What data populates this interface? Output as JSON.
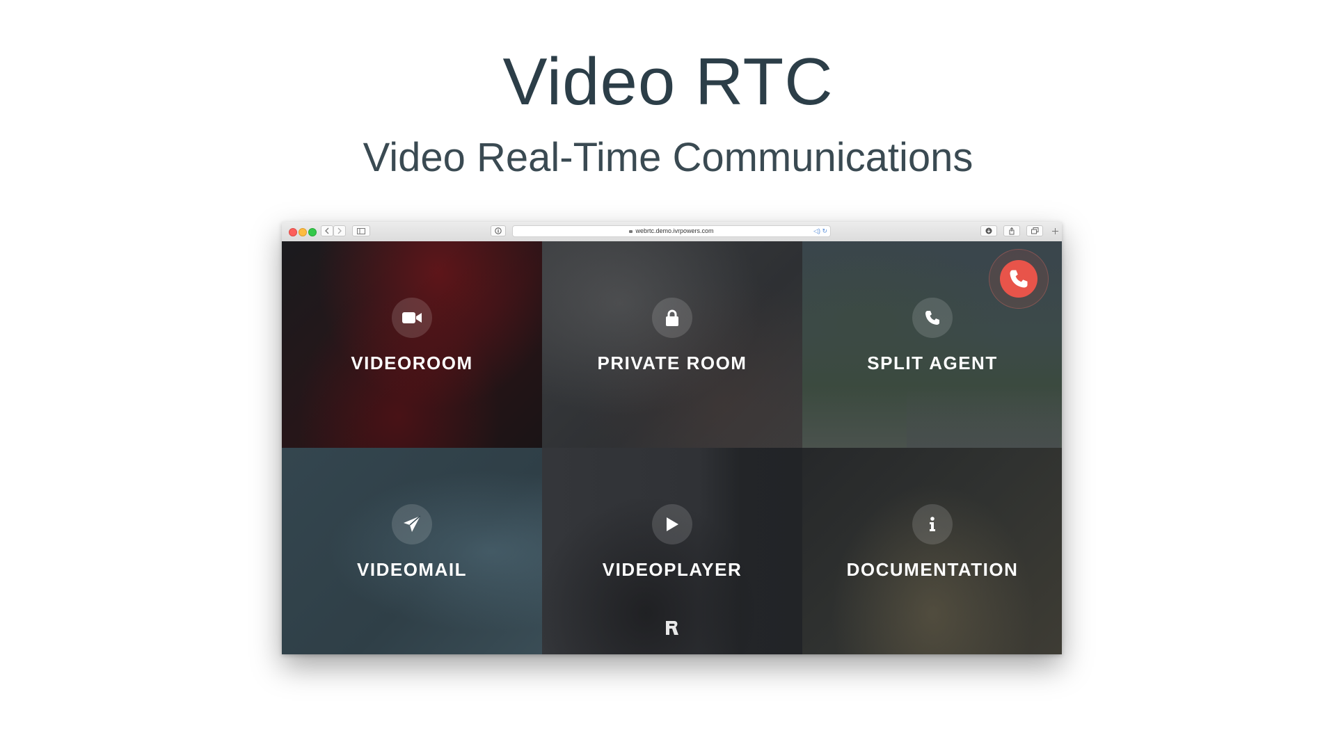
{
  "page": {
    "title": "Video RTC",
    "subtitle": "Video Real-Time Communications"
  },
  "browser": {
    "url": "webrtc.demo.ivrpowers.com"
  },
  "tiles": [
    {
      "label": "VIDEOROOM",
      "icon": "video-camera-icon"
    },
    {
      "label": "PRIVATE ROOM",
      "icon": "lock-icon"
    },
    {
      "label": "SPLIT AGENT",
      "icon": "phone-icon"
    },
    {
      "label": "VIDEOMAIL",
      "icon": "paper-plane-icon"
    },
    {
      "label": "VIDEOPLAYER",
      "icon": "play-icon"
    },
    {
      "label": "DOCUMENTATION",
      "icon": "info-icon"
    }
  ],
  "colors": {
    "title": "#2c3e48",
    "hangup": "#e8544a",
    "tile_text": "#ffffff"
  }
}
